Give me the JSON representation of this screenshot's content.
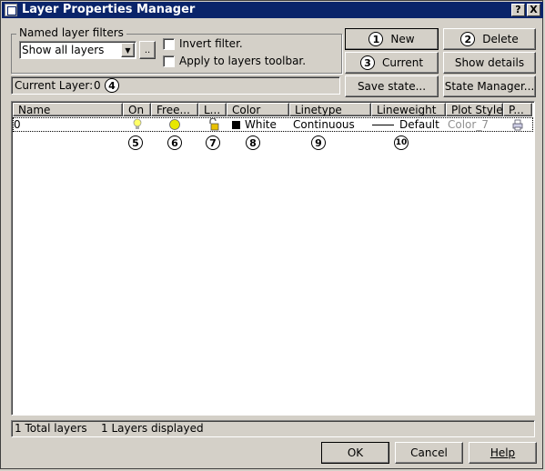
{
  "window": {
    "title": "Layer Properties Manager",
    "help_button": "?",
    "close_button": "X"
  },
  "filters": {
    "group_label": "Named layer filters",
    "selected": "Show all layers",
    "browse_button": "..",
    "invert_label": "Invert filter.",
    "apply_label": "Apply to layers toolbar."
  },
  "buttons": {
    "new": {
      "num": "1",
      "label": "New"
    },
    "delete": {
      "num": "2",
      "label": "Delete"
    },
    "current": {
      "num": "3",
      "label": "Current"
    },
    "show_details": "Show details",
    "save_state": "Save state...",
    "state_manager": "State Manager..."
  },
  "current_layer": {
    "label": "Current Layer:",
    "value": "0",
    "num": "4"
  },
  "table": {
    "headers": [
      "Name",
      "On",
      "Free...",
      "L...",
      "Color",
      "Linetype",
      "Lineweight",
      "Plot Style",
      "P..."
    ],
    "rows": [
      {
        "name": "0",
        "on": "bulb-on",
        "freeze": "sun-thawed",
        "lock": "lock-open",
        "color": "White",
        "color_swatch": "#000000",
        "linetype": "Continuous",
        "lineweight": "Default",
        "plot_style": "Color_7",
        "plot": "printer"
      }
    ],
    "callouts": [
      "5",
      "6",
      "7",
      "8",
      "9",
      "10"
    ]
  },
  "status": {
    "total": "1 Total layers",
    "displayed": "1 Layers displayed"
  },
  "footer": {
    "ok": "OK",
    "cancel": "Cancel",
    "help": "Help"
  }
}
